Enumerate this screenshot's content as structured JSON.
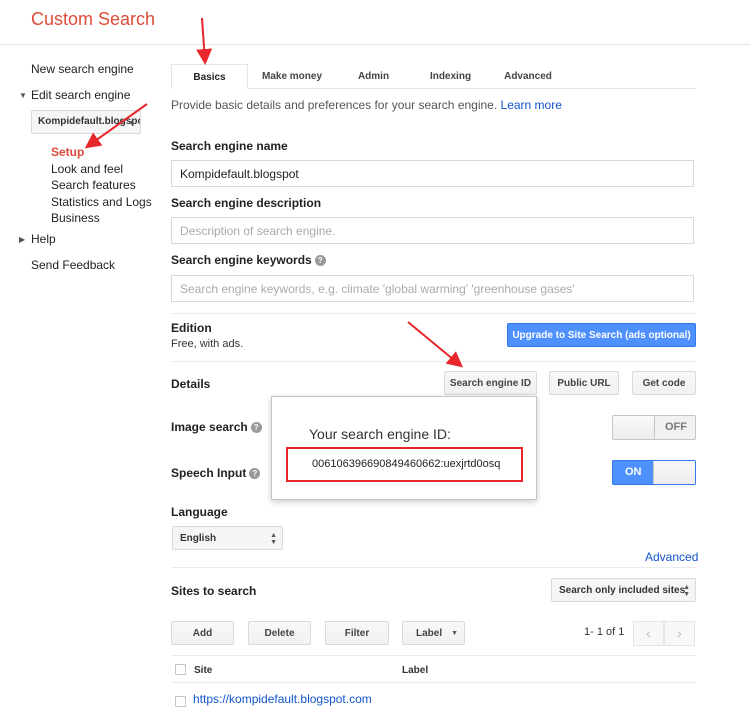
{
  "app": {
    "title": "Custom Search"
  },
  "sidebar": {
    "new_engine": "New search engine",
    "edit_engine": "Edit search engine",
    "engine_select": "Kompidefault.blogspot",
    "sub_items": [
      "Setup",
      "Look and feel",
      "Search features",
      "Statistics and Logs",
      "Business"
    ],
    "help": "Help",
    "feedback": "Send Feedback"
  },
  "tabs": [
    "Basics",
    "Make money",
    "Admin",
    "Indexing",
    "Advanced"
  ],
  "intro": {
    "text": "Provide basic details and preferences for your search engine.",
    "link": "Learn more"
  },
  "form": {
    "name_label": "Search engine name",
    "name_value": "Kompidefault.blogspot",
    "desc_label": "Search engine description",
    "desc_placeholder": "Description of search engine.",
    "keywords_label": "Search engine keywords",
    "keywords_placeholder": "Search engine keywords, e.g. climate 'global warming' 'greenhouse gases'"
  },
  "edition": {
    "label": "Edition",
    "value": "Free, with ads.",
    "upgrade_button": "Upgrade to Site Search (ads optional)"
  },
  "details": {
    "label": "Details",
    "engine_id_button": "Search engine ID",
    "public_url_button": "Public URL",
    "get_code_button": "Get code"
  },
  "image_search": {
    "label": "Image search",
    "state": "OFF"
  },
  "speech_input": {
    "label": "Speech Input",
    "state": "ON"
  },
  "popup": {
    "title": "Your search engine ID:",
    "id_value": "006106396690849460662:uexjrtd0osq"
  },
  "language": {
    "label": "Language",
    "value": "English"
  },
  "advanced_link": "Advanced",
  "sites": {
    "label": "Sites to search",
    "filter_select": "Search only included sites",
    "add": "Add",
    "delete": "Delete",
    "filter": "Filter",
    "label_button": "Label",
    "pager": "1- 1 of 1",
    "col_site": "Site",
    "col_label": "Label",
    "rows": [
      {
        "site": "https://kompidefault.blogspot.com"
      }
    ]
  },
  "colors": {
    "brand": "#dd4b39",
    "link": "#1155cc",
    "primary": "#4d90fe",
    "highlight": "#e8262b"
  },
  "icons": [
    "question-icon",
    "caret-down-icon",
    "caret-right-icon",
    "chevron-left-icon",
    "chevron-right-icon"
  ]
}
